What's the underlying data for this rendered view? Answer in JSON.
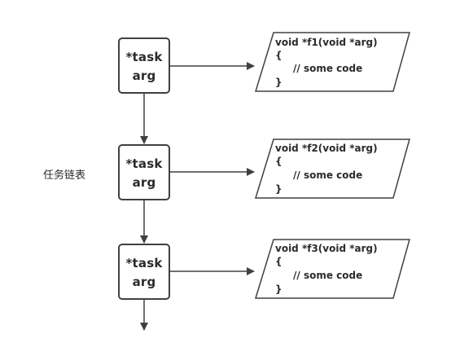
{
  "side_label": "任务链表",
  "tasks": [
    {
      "line1": "*task",
      "line2": "arg",
      "code": [
        "void *f1(void *arg)",
        "{",
        "// some code",
        "}"
      ]
    },
    {
      "line1": "*task",
      "line2": "arg",
      "code": [
        "void *f2(void *arg)",
        "{",
        "// some code",
        "}"
      ]
    },
    {
      "line1": "*task",
      "line2": "arg",
      "code": [
        "void *f3(void *arg)",
        "{",
        "// some code",
        "}"
      ]
    }
  ],
  "colors": {
    "stroke": "#404040",
    "text": "#2b2b2b",
    "background": "#ffffff"
  }
}
